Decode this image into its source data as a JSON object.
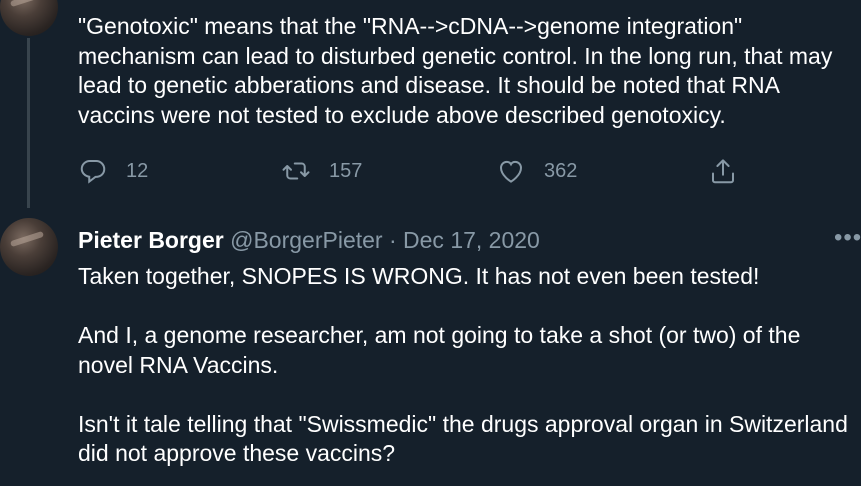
{
  "tweets": [
    {
      "text": "\"Genotoxic\" means that the \"RNA-->cDNA-->genome integration\" mechanism can lead to disturbed genetic control. In the long run, that may lead to genetic abberations and disease. It should be noted that RNA vaccins were not tested to exclude above described genotoxicy.",
      "actions": {
        "reply_count": "12",
        "retweet_count": "157",
        "like_count": "362"
      }
    },
    {
      "author_name": "Pieter Borger",
      "author_handle": "@BorgerPieter",
      "separator": "·",
      "date": "Dec 17, 2020",
      "more": "•••",
      "text": "Taken together, SNOPES IS WRONG. It has not even been tested!\n\nAnd I, a genome researcher, am not going to take a shot (or two) of the novel RNA Vaccins.\n\nIsn't it tale telling that \"Swissmedic\" the drugs approval organ in Switzerland did not approve these vaccins?"
    }
  ],
  "colors": {
    "background": "#15202b",
    "text": "#ffffff",
    "secondary": "#8899a6",
    "thread_line": "#38444d"
  },
  "icons": {
    "reply": "reply-icon",
    "retweet": "retweet-icon",
    "like": "heart-icon",
    "share": "share-icon",
    "more": "more-icon"
  }
}
